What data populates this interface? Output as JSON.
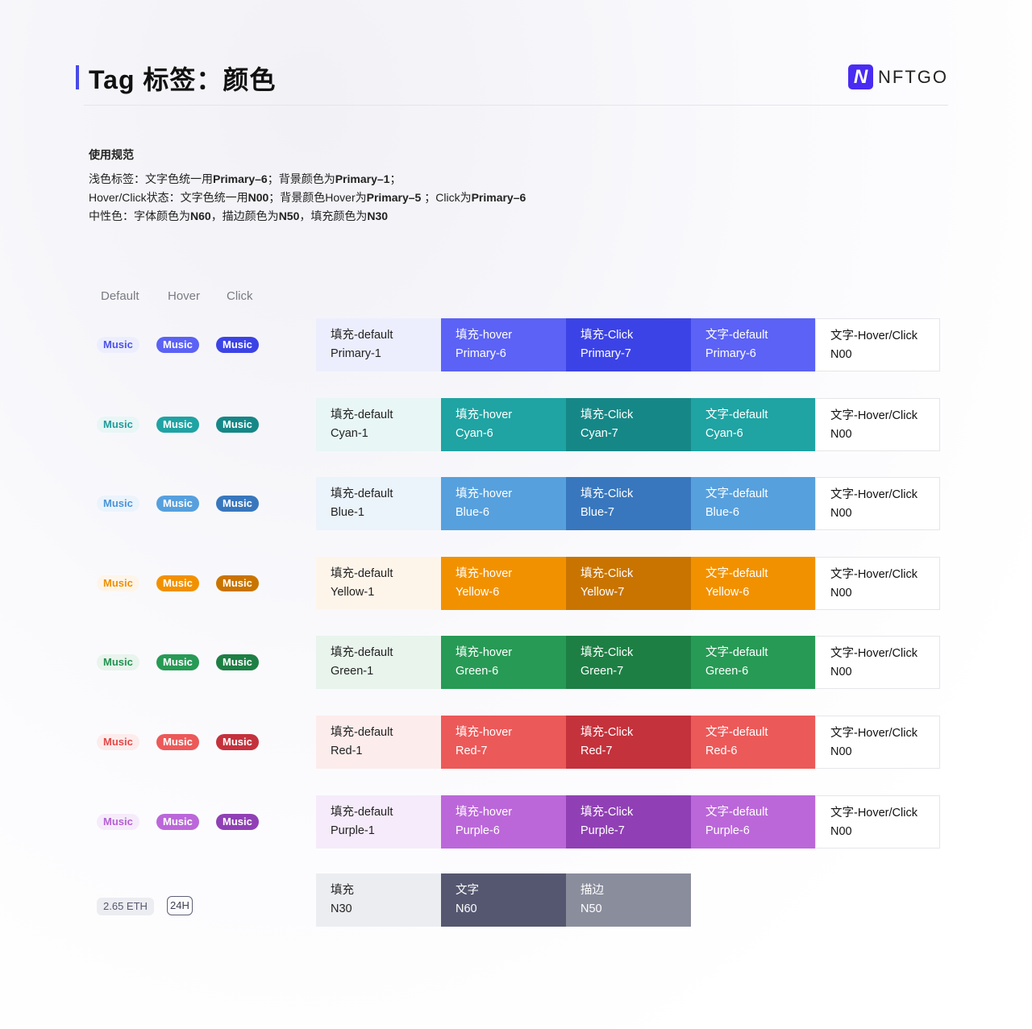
{
  "header": {
    "title": "Tag 标签：颜色",
    "logo_mark": "N",
    "logo_text": "NFTGO",
    "accent": "#4a4ae8"
  },
  "usage": {
    "heading": "使用规范",
    "line1": [
      {
        "t": "浅色标签：文字色统一用",
        "b": false
      },
      {
        "t": "Primary–6",
        "b": true
      },
      {
        "t": "；背景颜色为",
        "b": false
      },
      {
        "t": "Primary–1",
        "b": true
      },
      {
        "t": "；",
        "b": false
      }
    ],
    "line2": [
      {
        "t": "Hover/Click状态：文字色统一用",
        "b": false
      },
      {
        "t": "N00",
        "b": true
      },
      {
        "t": "；背景颜色Hover为",
        "b": false
      },
      {
        "t": "Primary–5",
        "b": true
      },
      {
        "t": " ；Click为",
        "b": false
      },
      {
        "t": "Primary–6",
        "b": true
      }
    ],
    "line3": [
      {
        "t": "中性色：字体颜色为",
        "b": false
      },
      {
        "t": "N60",
        "b": true
      },
      {
        "t": "，描边颜色为",
        "b": false
      },
      {
        "t": "N50",
        "b": true
      },
      {
        "t": "，填充颜色为",
        "b": false
      },
      {
        "t": "N30",
        "b": true
      }
    ]
  },
  "states": [
    "Default",
    "Hover",
    "Click"
  ],
  "tag_label": "Music",
  "rows": [
    {
      "name": "primary",
      "colors": {
        "light": "#eceefd",
        "six": "#5b62f5",
        "seven": "#3c43e6",
        "text": "#4b52ea"
      },
      "swatches": [
        [
          "填充-default",
          "Primary-1"
        ],
        [
          "填充-hover",
          "Primary-6"
        ],
        [
          "填充-Click",
          "Primary-7"
        ],
        [
          "文字-default",
          "Primary-6"
        ],
        [
          "文字-Hover/Click",
          "N00"
        ]
      ]
    },
    {
      "name": "cyan",
      "colors": {
        "light": "#e8f6f5",
        "six": "#1fa3a3",
        "seven": "#168787",
        "text": "#1e9b9b"
      },
      "swatches": [
        [
          "填充-default",
          "Cyan-1"
        ],
        [
          "填充-hover",
          "Cyan-6"
        ],
        [
          "填充-Click",
          "Cyan-7"
        ],
        [
          "文字-default",
          "Cyan-6"
        ],
        [
          "文字-Hover/Click",
          "N00"
        ]
      ]
    },
    {
      "name": "blue",
      "colors": {
        "light": "#ebf3fb",
        "six": "#56a0de",
        "seven": "#3877bd",
        "text": "#4a94d6"
      },
      "swatches": [
        [
          "填充-default",
          "Blue-1"
        ],
        [
          "填充-hover",
          "Blue-6"
        ],
        [
          "填充-Click",
          "Blue-7"
        ],
        [
          "文字-default",
          "Blue-6"
        ],
        [
          "文字-Hover/Click",
          "N00"
        ]
      ]
    },
    {
      "name": "yellow",
      "colors": {
        "light": "#fef5ea",
        "six": "#f29100",
        "seven": "#c97400",
        "text": "#ef8f00"
      },
      "swatches": [
        [
          "填充-default",
          "Yellow-1"
        ],
        [
          "填充-hover",
          "Yellow-6"
        ],
        [
          "填充-Click",
          "Yellow-7"
        ],
        [
          "文字-default",
          "Yellow-6"
        ],
        [
          "文字-Hover/Click",
          "N00"
        ]
      ]
    },
    {
      "name": "green",
      "colors": {
        "light": "#e8f4ec",
        "six": "#279a55",
        "seven": "#1d7f44",
        "text": "#21914f"
      },
      "swatches": [
        [
          "填充-default",
          "Green-1"
        ],
        [
          "填充-hover",
          "Green-6"
        ],
        [
          "填充-Click",
          "Green-7"
        ],
        [
          "文字-default",
          "Green-6"
        ],
        [
          "文字-Hover/Click",
          "N00"
        ]
      ]
    },
    {
      "name": "red",
      "colors": {
        "light": "#fdecec",
        "six": "#ec5959",
        "seven": "#c4323c",
        "text": "#e24848"
      },
      "swatches": [
        [
          "填充-default",
          "Red-1"
        ],
        [
          "填充-hover",
          "Red-7"
        ],
        [
          "填充-Click",
          "Red-7"
        ],
        [
          "文字-default",
          "Red-6"
        ],
        [
          "文字-Hover/Click",
          "N00"
        ]
      ]
    },
    {
      "name": "purple",
      "colors": {
        "light": "#f6ebfa",
        "six": "#bb67d9",
        "seven": "#9040b4",
        "text": "#b460d3"
      },
      "swatches": [
        [
          "填充-default",
          "Purple-1"
        ],
        [
          "填充-hover",
          "Purple-6"
        ],
        [
          "填充-Click",
          "Purple-7"
        ],
        [
          "文字-default",
          "Purple-6"
        ],
        [
          "文字-Hover/Click",
          "N00"
        ]
      ]
    }
  ],
  "neutral": {
    "eth_tag": "2.65 ETH",
    "h24_tag": "24H",
    "swatches": [
      {
        "title": "填充",
        "token": "N30",
        "bg": "#ecedf1",
        "fg": "#222"
      },
      {
        "title": "文字",
        "token": "N60",
        "bg": "#555770",
        "fg": "#fff"
      },
      {
        "title": "描边",
        "token": "N50",
        "bg": "#8a8d9c",
        "fg": "#fff"
      }
    ]
  }
}
